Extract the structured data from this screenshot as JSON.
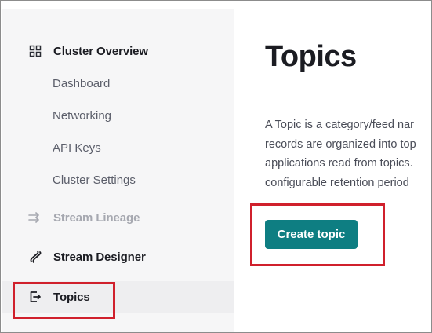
{
  "sidebar": {
    "cluster_overview": {
      "label": "Cluster Overview",
      "icon": "grid-icon"
    },
    "sub_items": [
      {
        "label": "Dashboard"
      },
      {
        "label": "Networking"
      },
      {
        "label": "API Keys"
      },
      {
        "label": "Cluster Settings"
      }
    ],
    "stream_lineage": {
      "label": "Stream Lineage",
      "icon": "stream-lineage-icon",
      "disabled": true
    },
    "stream_designer": {
      "label": "Stream Designer",
      "icon": "stream-designer-icon"
    },
    "topics": {
      "label": "Topics",
      "icon": "topics-icon",
      "active": true
    }
  },
  "main": {
    "title": "Topics",
    "description_lines": [
      "A Topic is a category/feed nar",
      "records are organized into top",
      "applications read from topics.",
      "configurable retention period"
    ],
    "create_button_label": "Create topic"
  },
  "colors": {
    "accent": "#0e7e82",
    "highlight": "#d0202c",
    "sidebar_bg": "#f6f6f7"
  }
}
